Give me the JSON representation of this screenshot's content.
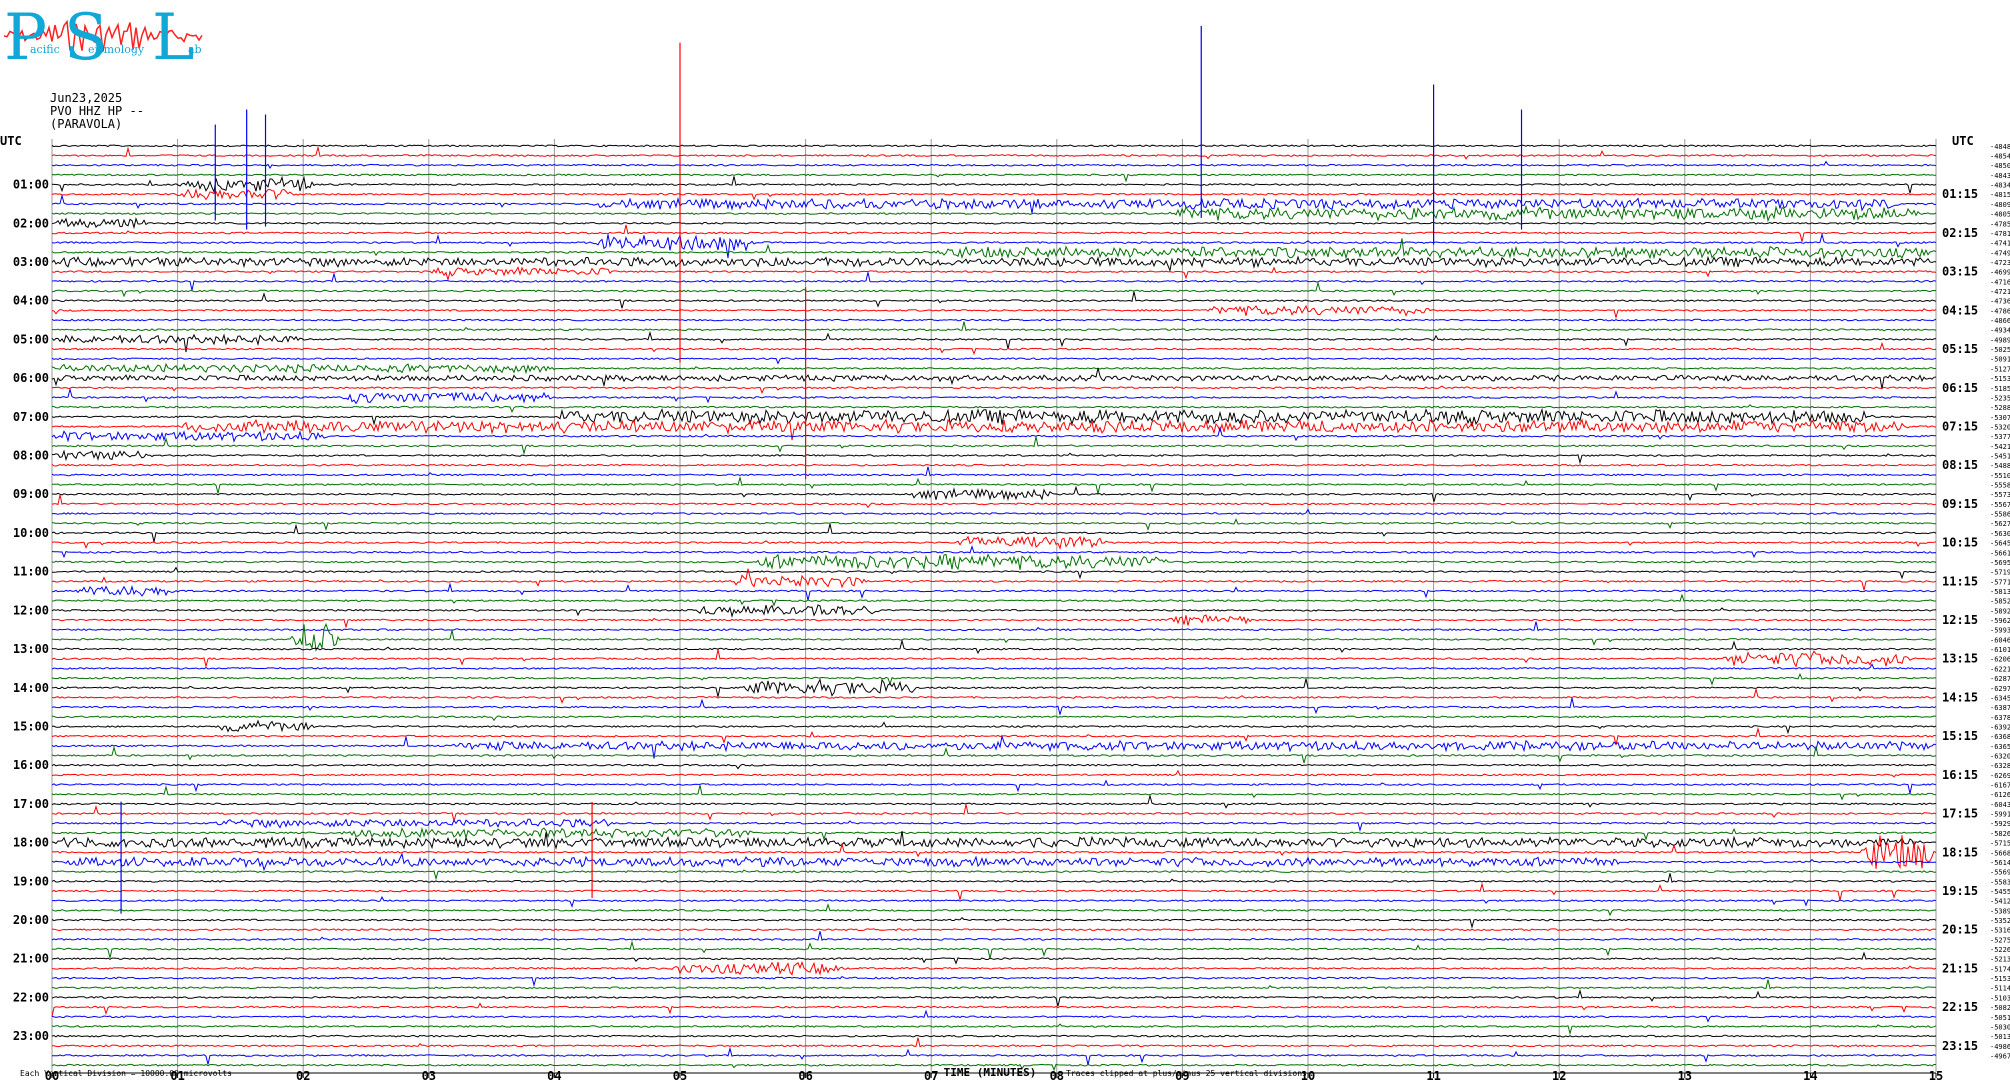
{
  "logo": {
    "letters": [
      "P",
      "S",
      "L"
    ],
    "words": [
      "acific",
      "eismology",
      "ab"
    ],
    "color": "#11a7d6",
    "wave_color": "#ff2020"
  },
  "header": {
    "date": "Jun23,2025",
    "station": "PVO HHZ HP --",
    "location": "(PARAVOLA)"
  },
  "chart_data": {
    "type": "line",
    "title": "",
    "left_axis_title": "UTC",
    "right_axis_title": "UTC",
    "xlabel": "TIME (MINUTES)",
    "x_ticks": [
      "00",
      "01",
      "02",
      "03",
      "04",
      "05",
      "06",
      "07",
      "08",
      "09",
      "10",
      "11",
      "12",
      "13",
      "14",
      "15"
    ],
    "xlim": [
      0,
      15
    ],
    "left_hour_labels": [
      "01:00",
      "02:00",
      "03:00",
      "04:00",
      "05:00",
      "06:00",
      "07:00",
      "08:00",
      "09:00",
      "10:00",
      "11:00",
      "12:00",
      "13:00",
      "14:00",
      "15:00",
      "16:00",
      "17:00",
      "18:00",
      "19:00",
      "20:00",
      "21:00",
      "22:00",
      "23:00"
    ],
    "right_hour_labels": [
      "01:15",
      "02:15",
      "03:15",
      "04:15",
      "05:15",
      "06:15",
      "07:15",
      "08:15",
      "09:15",
      "10:15",
      "11:15",
      "12:15",
      "13:15",
      "14:15",
      "15:15",
      "16:15",
      "17:15",
      "18:15",
      "19:15",
      "20:15",
      "21:15",
      "22:15",
      "23:15"
    ],
    "trace_count": 96,
    "trace_minutes": 15,
    "trace_colors": [
      "#000000",
      "#ff0000",
      "#0000ff",
      "#007000"
    ],
    "offsets": [
      "-4848",
      "-4854",
      "-4850",
      "-4843",
      "-4834",
      "-4815",
      "-4809",
      "-4805",
      "-4785",
      "-4781",
      "-4741",
      "-4749",
      "-4723",
      "-4699",
      "-4716",
      "-4721",
      "-4736",
      "-4786",
      "-4866",
      "-4934",
      "-4989",
      "-5025",
      "-5091",
      "-5127",
      "-5153",
      "-5185",
      "-5235",
      "-5288",
      "-5307",
      "-5320",
      "-5377",
      "-5421",
      "-5451",
      "-5488",
      "-5510",
      "-5558",
      "-5573",
      "-5567",
      "-5586",
      "-5627",
      "-5630",
      "-5645",
      "-5661",
      "-5695",
      "-5719",
      "-5771",
      "-5813",
      "-5852",
      "-5892",
      "-5962",
      "-5993",
      "-6046",
      "-6101",
      "-6206",
      "-6221",
      "-6287",
      "-6297",
      "-6345",
      "-6387",
      "-6378",
      "-6392",
      "-6368",
      "-6365",
      "-6320",
      "-6328",
      "-6269",
      "-6167",
      "-6126",
      "-6043",
      "-5991",
      "-5929",
      "-5826",
      "-5715",
      "-5668",
      "-5614",
      "-5569",
      "-5583",
      "-5455",
      "-5412",
      "-5389",
      "-5352",
      "-5316",
      "-5275",
      "-5226",
      "-5213",
      "-5174",
      "-5153",
      "-5114",
      "-5103",
      "-5082",
      "-5051",
      "-5030",
      "-5013",
      "-4986",
      "-4967"
    ],
    "bursts": [
      {
        "trace": 4,
        "start": 1.0,
        "end": 2.1,
        "amp": 1.4,
        "color_override": "#0000ff"
      },
      {
        "trace": 5,
        "start": 1.0,
        "end": 2.0,
        "amp": 1.2
      },
      {
        "trace": 6,
        "start": 4.3,
        "end": 14.7,
        "amp": 1.0
      },
      {
        "trace": 7,
        "start": 8.9,
        "end": 14.9,
        "amp": 1.3
      },
      {
        "trace": 8,
        "start": 0.0,
        "end": 0.8,
        "amp": 0.9
      },
      {
        "trace": 10,
        "start": 4.3,
        "end": 5.6,
        "amp": 1.6
      },
      {
        "trace": 11,
        "start": 7.0,
        "end": 15.0,
        "amp": 1.1
      },
      {
        "trace": 12,
        "start": 0.0,
        "end": 15.0,
        "amp": 0.9
      },
      {
        "trace": 13,
        "start": 3.0,
        "end": 4.5,
        "amp": 0.8
      },
      {
        "trace": 17,
        "start": 9.2,
        "end": 11.0,
        "amp": 1.0
      },
      {
        "trace": 20,
        "start": 0.0,
        "end": 2.0,
        "amp": 0.9
      },
      {
        "trace": 23,
        "start": 0.0,
        "end": 4.0,
        "amp": 0.8
      },
      {
        "trace": 24,
        "start": 0.0,
        "end": 15.0,
        "amp": 0.5
      },
      {
        "trace": 26,
        "start": 2.3,
        "end": 4.0,
        "amp": 1.2
      },
      {
        "trace": 28,
        "start": 4.0,
        "end": 14.5,
        "amp": 1.5
      },
      {
        "trace": 29,
        "start": 1.0,
        "end": 14.8,
        "amp": 1.3
      },
      {
        "trace": 30,
        "start": 0.0,
        "end": 2.2,
        "amp": 0.9
      },
      {
        "trace": 32,
        "start": 0.0,
        "end": 0.8,
        "amp": 0.9
      },
      {
        "trace": 36,
        "start": 6.8,
        "end": 8.0,
        "amp": 1.0
      },
      {
        "trace": 41,
        "start": 7.2,
        "end": 8.4,
        "amp": 1.3
      },
      {
        "trace": 43,
        "start": 5.6,
        "end": 8.9,
        "amp": 1.5
      },
      {
        "trace": 45,
        "start": 5.4,
        "end": 6.5,
        "amp": 1.2
      },
      {
        "trace": 46,
        "start": 0.2,
        "end": 1.0,
        "amp": 1.1
      },
      {
        "trace": 48,
        "start": 5.1,
        "end": 6.6,
        "amp": 1.1
      },
      {
        "trace": 49,
        "start": 8.9,
        "end": 9.6,
        "amp": 1.0
      },
      {
        "trace": 51,
        "start": 1.9,
        "end": 2.3,
        "amp": 3.5
      },
      {
        "trace": 53,
        "start": 13.3,
        "end": 14.8,
        "amp": 1.6
      },
      {
        "trace": 56,
        "start": 5.5,
        "end": 6.9,
        "amp": 1.6
      },
      {
        "trace": 60,
        "start": 1.3,
        "end": 2.1,
        "amp": 1.0
      },
      {
        "trace": 62,
        "start": 3.2,
        "end": 15.0,
        "amp": 0.9
      },
      {
        "trace": 70,
        "start": 1.3,
        "end": 4.5,
        "amp": 0.8
      },
      {
        "trace": 71,
        "start": 2.3,
        "end": 5.6,
        "amp": 0.9
      },
      {
        "trace": 72,
        "start": 0.0,
        "end": 14.9,
        "amp": 1.0
      },
      {
        "trace": 73,
        "start": 14.4,
        "end": 15.0,
        "amp": 4.0
      },
      {
        "trace": 74,
        "start": 0.1,
        "end": 12.5,
        "amp": 0.9
      },
      {
        "trace": 85,
        "start": 4.9,
        "end": 6.3,
        "amp": 1.2
      }
    ],
    "spikes": [
      {
        "trace": 4,
        "minute": 1.3,
        "height": 60,
        "color": "#0000ff"
      },
      {
        "trace": 4,
        "minute": 1.55,
        "height": 75,
        "color": "#0000ff"
      },
      {
        "trace": 4,
        "minute": 1.7,
        "height": 70,
        "color": "#0000ff"
      },
      {
        "trace": 4,
        "minute": 11.0,
        "height": 100,
        "color": "#0000ff"
      },
      {
        "trace": 4,
        "minute": 11.7,
        "height": 75,
        "color": "#0000ff"
      },
      {
        "trace": 0,
        "minute": 9.15,
        "height": 120,
        "color": "#0000ff"
      },
      {
        "trace": 10,
        "minute": 5.0,
        "height": 200,
        "color": "#ff0000"
      },
      {
        "trace": 27,
        "minute": 6.0,
        "height": 120,
        "color": "#ff0000"
      },
      {
        "trace": 74,
        "minute": 4.3,
        "height": 60,
        "color": "#ff0000"
      },
      {
        "trace": 75,
        "minute": 0.55,
        "height": 70,
        "color": "#0000ff"
      }
    ],
    "footer_left": "Each Vertical Division = 10000.00 microvolts",
    "footer_right": "Traces clipped at plus/minus 25 vertical divisions"
  }
}
